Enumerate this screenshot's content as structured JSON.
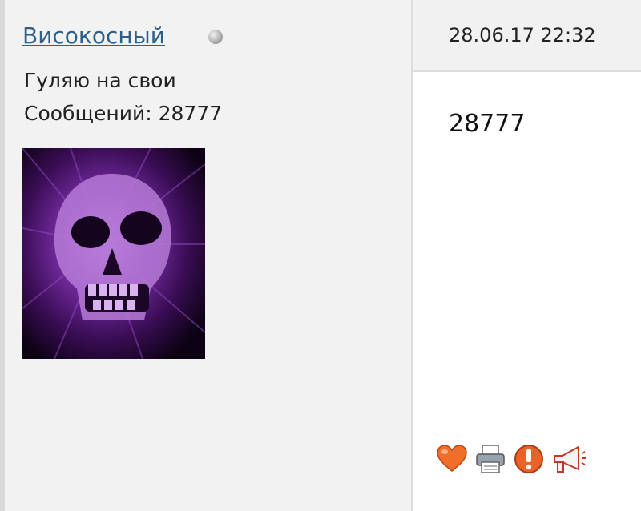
{
  "post": {
    "author": {
      "username": "Високосный",
      "online_status": "offline",
      "title": "Гуляю на свои",
      "post_count_label": "Сообщений: 28777",
      "avatar": "purple-skull-image"
    },
    "date": "28.06.17 22:32",
    "message": "28777",
    "actions": [
      {
        "name": "like",
        "icon": "heart-icon"
      },
      {
        "name": "print",
        "icon": "printer-icon"
      },
      {
        "name": "report",
        "icon": "warning-icon"
      },
      {
        "name": "announce",
        "icon": "megaphone-icon"
      }
    ]
  },
  "colors": {
    "username_link": "#2e5f8a",
    "left_panel_bg": "#f2f2f2",
    "heart": "#f06e2a",
    "warning": "#e8622a"
  }
}
